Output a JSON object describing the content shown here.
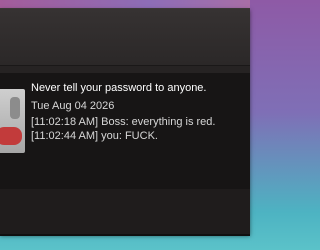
{
  "notification": {
    "title": "Never tell your password to anyone.",
    "date": "Tue Aug 04 2026",
    "messages": [
      "[11:02:18 AM] Boss: everything is red.",
      "[11:02:44 AM] you: FUCK."
    ]
  },
  "colors": {
    "window_bg": "#262323",
    "content_bg": "#171515",
    "title_text": "#ffffff",
    "body_text": "#d7d7d7",
    "backdrop_top": "#8e5aa6",
    "backdrop_bottom": "#5bc2c9"
  }
}
